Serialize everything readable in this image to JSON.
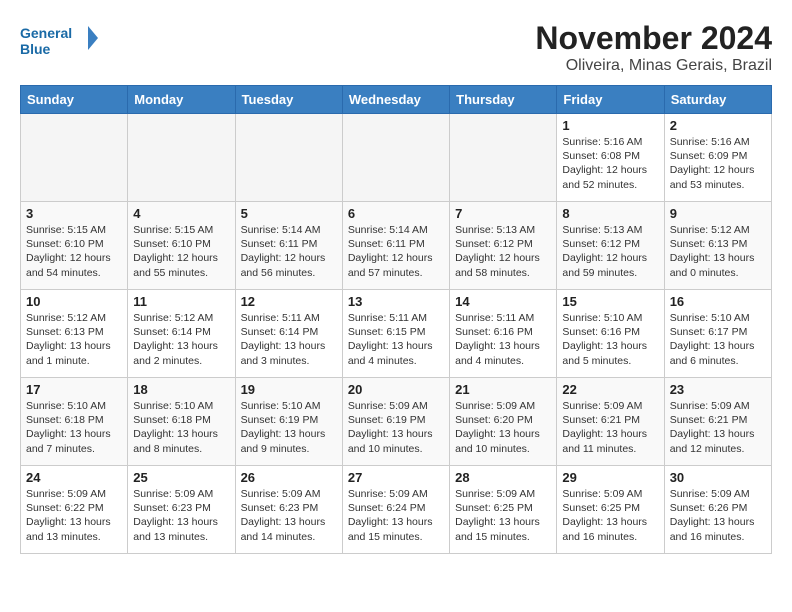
{
  "header": {
    "logo_line1": "General",
    "logo_line2": "Blue",
    "month": "November 2024",
    "location": "Oliveira, Minas Gerais, Brazil"
  },
  "days_of_week": [
    "Sunday",
    "Monday",
    "Tuesday",
    "Wednesday",
    "Thursday",
    "Friday",
    "Saturday"
  ],
  "weeks": [
    [
      {
        "day": "",
        "info": ""
      },
      {
        "day": "",
        "info": ""
      },
      {
        "day": "",
        "info": ""
      },
      {
        "day": "",
        "info": ""
      },
      {
        "day": "",
        "info": ""
      },
      {
        "day": "1",
        "info": "Sunrise: 5:16 AM\nSunset: 6:08 PM\nDaylight: 12 hours\nand 52 minutes."
      },
      {
        "day": "2",
        "info": "Sunrise: 5:16 AM\nSunset: 6:09 PM\nDaylight: 12 hours\nand 53 minutes."
      }
    ],
    [
      {
        "day": "3",
        "info": "Sunrise: 5:15 AM\nSunset: 6:10 PM\nDaylight: 12 hours\nand 54 minutes."
      },
      {
        "day": "4",
        "info": "Sunrise: 5:15 AM\nSunset: 6:10 PM\nDaylight: 12 hours\nand 55 minutes."
      },
      {
        "day": "5",
        "info": "Sunrise: 5:14 AM\nSunset: 6:11 PM\nDaylight: 12 hours\nand 56 minutes."
      },
      {
        "day": "6",
        "info": "Sunrise: 5:14 AM\nSunset: 6:11 PM\nDaylight: 12 hours\nand 57 minutes."
      },
      {
        "day": "7",
        "info": "Sunrise: 5:13 AM\nSunset: 6:12 PM\nDaylight: 12 hours\nand 58 minutes."
      },
      {
        "day": "8",
        "info": "Sunrise: 5:13 AM\nSunset: 6:12 PM\nDaylight: 12 hours\nand 59 minutes."
      },
      {
        "day": "9",
        "info": "Sunrise: 5:12 AM\nSunset: 6:13 PM\nDaylight: 13 hours\nand 0 minutes."
      }
    ],
    [
      {
        "day": "10",
        "info": "Sunrise: 5:12 AM\nSunset: 6:13 PM\nDaylight: 13 hours\nand 1 minute."
      },
      {
        "day": "11",
        "info": "Sunrise: 5:12 AM\nSunset: 6:14 PM\nDaylight: 13 hours\nand 2 minutes."
      },
      {
        "day": "12",
        "info": "Sunrise: 5:11 AM\nSunset: 6:14 PM\nDaylight: 13 hours\nand 3 minutes."
      },
      {
        "day": "13",
        "info": "Sunrise: 5:11 AM\nSunset: 6:15 PM\nDaylight: 13 hours\nand 4 minutes."
      },
      {
        "day": "14",
        "info": "Sunrise: 5:11 AM\nSunset: 6:16 PM\nDaylight: 13 hours\nand 4 minutes."
      },
      {
        "day": "15",
        "info": "Sunrise: 5:10 AM\nSunset: 6:16 PM\nDaylight: 13 hours\nand 5 minutes."
      },
      {
        "day": "16",
        "info": "Sunrise: 5:10 AM\nSunset: 6:17 PM\nDaylight: 13 hours\nand 6 minutes."
      }
    ],
    [
      {
        "day": "17",
        "info": "Sunrise: 5:10 AM\nSunset: 6:18 PM\nDaylight: 13 hours\nand 7 minutes."
      },
      {
        "day": "18",
        "info": "Sunrise: 5:10 AM\nSunset: 6:18 PM\nDaylight: 13 hours\nand 8 minutes."
      },
      {
        "day": "19",
        "info": "Sunrise: 5:10 AM\nSunset: 6:19 PM\nDaylight: 13 hours\nand 9 minutes."
      },
      {
        "day": "20",
        "info": "Sunrise: 5:09 AM\nSunset: 6:19 PM\nDaylight: 13 hours\nand 10 minutes."
      },
      {
        "day": "21",
        "info": "Sunrise: 5:09 AM\nSunset: 6:20 PM\nDaylight: 13 hours\nand 10 minutes."
      },
      {
        "day": "22",
        "info": "Sunrise: 5:09 AM\nSunset: 6:21 PM\nDaylight: 13 hours\nand 11 minutes."
      },
      {
        "day": "23",
        "info": "Sunrise: 5:09 AM\nSunset: 6:21 PM\nDaylight: 13 hours\nand 12 minutes."
      }
    ],
    [
      {
        "day": "24",
        "info": "Sunrise: 5:09 AM\nSunset: 6:22 PM\nDaylight: 13 hours\nand 13 minutes."
      },
      {
        "day": "25",
        "info": "Sunrise: 5:09 AM\nSunset: 6:23 PM\nDaylight: 13 hours\nand 13 minutes."
      },
      {
        "day": "26",
        "info": "Sunrise: 5:09 AM\nSunset: 6:23 PM\nDaylight: 13 hours\nand 14 minutes."
      },
      {
        "day": "27",
        "info": "Sunrise: 5:09 AM\nSunset: 6:24 PM\nDaylight: 13 hours\nand 15 minutes."
      },
      {
        "day": "28",
        "info": "Sunrise: 5:09 AM\nSunset: 6:25 PM\nDaylight: 13 hours\nand 15 minutes."
      },
      {
        "day": "29",
        "info": "Sunrise: 5:09 AM\nSunset: 6:25 PM\nDaylight: 13 hours\nand 16 minutes."
      },
      {
        "day": "30",
        "info": "Sunrise: 5:09 AM\nSunset: 6:26 PM\nDaylight: 13 hours\nand 16 minutes."
      }
    ]
  ]
}
